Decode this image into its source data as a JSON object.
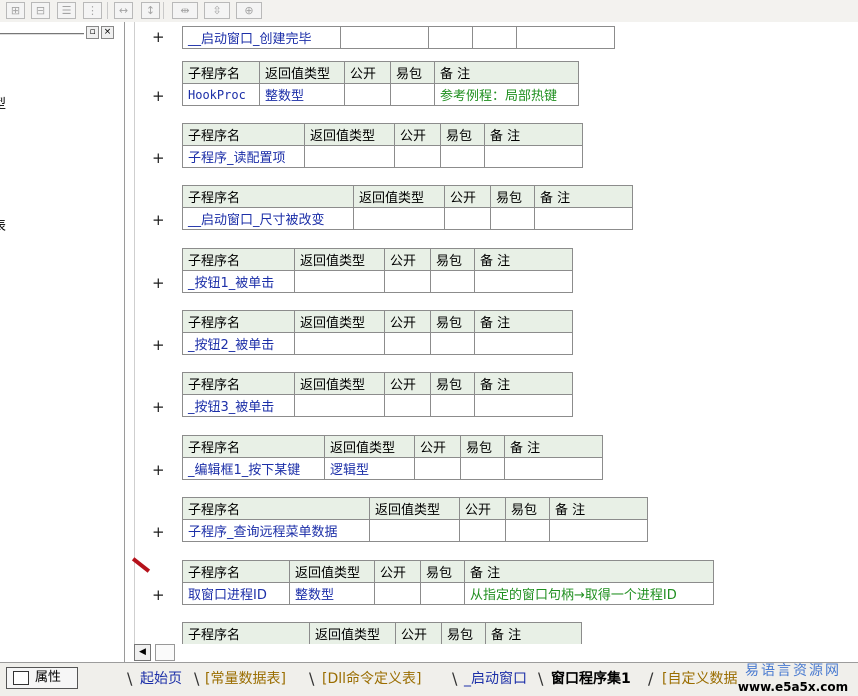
{
  "leftpane": {
    "close_glyph": "×",
    "restore_glyph": "▫",
    "partial_labels": [
      "型",
      "表"
    ]
  },
  "routines": [
    {
      "name": "__启动窗口_创建完毕",
      "ret": "",
      "comment": "",
      "header": false
    },
    {
      "name": "HookProc",
      "ret": "整数型",
      "comment": "参考例程：局部热键",
      "header": true
    },
    {
      "name": "子程序_读配置项",
      "ret": "",
      "comment": "",
      "header": true
    },
    {
      "name": "__启动窗口_尺寸被改变",
      "ret": "",
      "comment": "",
      "header": true
    },
    {
      "name": "_按钮1_被单击",
      "ret": "",
      "comment": "",
      "header": true
    },
    {
      "name": "_按钮2_被单击",
      "ret": "",
      "comment": "",
      "header": true
    },
    {
      "name": "_按钮3_被单击",
      "ret": "",
      "comment": "",
      "header": true
    },
    {
      "name": "_编辑框1_按下某键",
      "ret": "逻辑型",
      "comment": "",
      "header": true
    },
    {
      "name": "子程序_查询远程菜单数据",
      "ret": "",
      "comment": "",
      "header": true
    },
    {
      "name": "取窗口进程ID",
      "ret": "整数型",
      "comment": "从指定的窗口句柄→取得一个进程ID",
      "header": true
    },
    {
      "name": "",
      "ret": "",
      "comment": "",
      "header": true
    }
  ],
  "headers": {
    "name": "子程序名",
    "ret": "返回值类型",
    "public": "公开",
    "easy": "易包",
    "comment": "备 注"
  },
  "expand_glyph": "+",
  "bottom": {
    "property_label": "属性",
    "tabs": [
      "起始页",
      "[常量数据表]",
      "[Dll命令定义表]",
      "_启动窗口",
      "窗口程序集1",
      "[自定义数据"
    ],
    "active_tab": "窗口程序集1"
  },
  "watermark": {
    "title": "易语言资源网",
    "url": "www.e5a5x.com"
  },
  "colors": {
    "header_bg": "#e8f0e6",
    "name_blue": "#1c2fa8",
    "comment_green": "#1f8f1f",
    "tab_gold": "#9a6d00"
  }
}
